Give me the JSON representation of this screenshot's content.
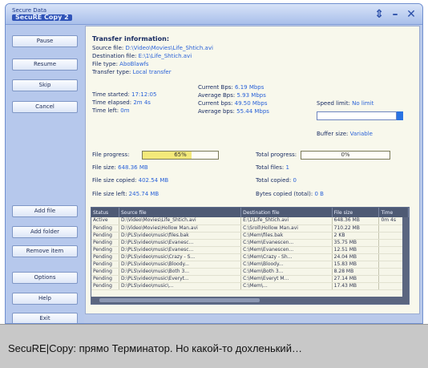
{
  "window": {
    "title_small": "Secure Data",
    "app_name": "SecuRE Copy 2"
  },
  "title_buttons": [
    "⇕",
    "–",
    "✕"
  ],
  "left_buttons": {
    "pause": "Pause",
    "resume": "Resume",
    "skip": "Skip",
    "cancel": "Cancel",
    "add_file": "Add file",
    "add_folder": "Add folder",
    "remove_item": "Remove item",
    "options": "Options",
    "help": "Help",
    "exit": "Exit"
  },
  "transfer": {
    "heading": "Transfer information:",
    "source_label": "Source file:",
    "source_value": "D:\\Video\\Movies\\Life_Shtich.avi",
    "dest_label": "Destination file:",
    "dest_value": "E:\\1\\Life_Shtich.avi",
    "type_label": "File type:",
    "type_value": "AboBlawfs",
    "transfer_type_label": "Transfer type:",
    "transfer_type_value": "Local transfer"
  },
  "times": {
    "started_label": "Time started:",
    "started_value": "17:12:05",
    "elapsed_label": "Time elapsed:",
    "elapsed_value": "2m 4s",
    "left_label": "Time left:",
    "left_value": "0m"
  },
  "speeds": {
    "current1_label": "Current Bps:",
    "current1_value": "6.19 Mbps",
    "avg1_label": "Average Bps:",
    "avg1_value": "5.93 Mbps",
    "current2_label": "Current bps:",
    "current2_value": "49.50 Mbps",
    "avg2_label": "Average bps:",
    "avg2_value": "55.44 Mbps",
    "limit_label": "Speed limit:",
    "limit_value": "No limit",
    "buffer_label": "Buffer size:",
    "buffer_value": "Variable"
  },
  "progress": {
    "file_label": "File progress:",
    "file_percent": 65,
    "file_text": "65%",
    "total_label": "Total progress:",
    "total_percent": 0,
    "total_text": "0%",
    "size_label": "File size:",
    "size_value": "648.36 MB",
    "copied_label": "File size copied:",
    "copied_value": "402.54 MB",
    "left_label": "File size left:",
    "left_value": "245.74 MB",
    "total_files_label": "Total files:",
    "total_files_value": "1",
    "total_copied_label": "Total copied:",
    "total_copied_value": "0",
    "bytes_label": "Bytes copied (total):",
    "bytes_value": "0 B"
  },
  "table": {
    "columns": [
      "Status",
      "Source file",
      "Destination file",
      "File size",
      "Time"
    ],
    "rows": [
      [
        "Active",
        "D:\\Video\\Movies\\Life_Shtich.avi",
        "E:\\1\\Life_Shtich.avi",
        "648.36 MB",
        "0m 4s"
      ],
      [
        "Pending",
        "D:\\Video\\Movies\\Hollow Man.avi",
        "C:\\Sroll\\Hollow Man.avi",
        "710.22 MB",
        ""
      ],
      [
        "Pending",
        "D:\\PLS\\video\\music\\files.bak",
        "C:\\Mem\\files.bak",
        "2 KB",
        ""
      ],
      [
        "Pending",
        "D:\\PLS\\video\\music\\Evanesc...",
        "C:\\Mem\\Evanescen...",
        "35.75 MB",
        ""
      ],
      [
        "Pending",
        "D:\\PLS\\video\\music\\Evanesc...",
        "C:\\Mem\\Evanescen...",
        "12.51 MB",
        ""
      ],
      [
        "Pending",
        "D:\\PLS\\video\\music\\Crazy - S...",
        "C:\\Mem\\Crazy - Sh...",
        "24.04 MB",
        ""
      ],
      [
        "Pending",
        "D:\\PLS\\video\\music\\Bloody...",
        "C:\\Mem\\Bloody...",
        "15.83 MB",
        ""
      ],
      [
        "Pending",
        "D:\\PLS\\video\\music\\Both 3...",
        "C:\\Mem\\Both 3...",
        "8.28 MB",
        ""
      ],
      [
        "Pending",
        "D:\\PLS\\video\\music\\Everyt...",
        "C:\\Mem\\Everyt M...",
        "27.14 MB",
        ""
      ],
      [
        "Pending",
        "D:\\PLS\\video\\music\\...",
        "C:\\Mem\\...",
        "17.43 MB",
        ""
      ]
    ]
  },
  "caption": "SecuRE|Copy: прямо Терминатор. Но какой-то дохленький…",
  "colors": {
    "window_bg": "#b9c9ea",
    "content_bg": "#f8f8ec",
    "value_blue": "#2a62d8",
    "table_header": "#4e5a74",
    "progress_fill": "#f3e97a"
  }
}
